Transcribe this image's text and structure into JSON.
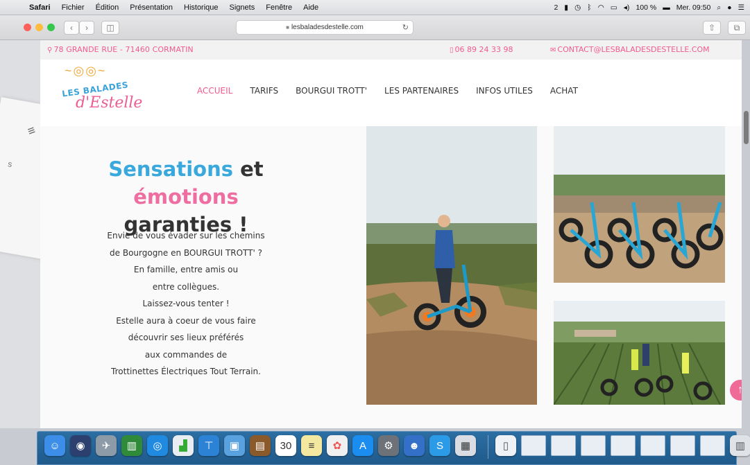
{
  "menubar": {
    "app": "Safari",
    "items": [
      "Fichier",
      "Édition",
      "Présentation",
      "Historique",
      "Signets",
      "Fenêtre",
      "Aide"
    ],
    "status": {
      "notif": "2",
      "battery": "100 %",
      "clock": "Mer. 09:50"
    }
  },
  "browser": {
    "url": "lesbaladesdestelle.com"
  },
  "site": {
    "topbar": {
      "address": "78 GRANDE RUE - 71460 CORMATIN",
      "phone": "06 89 24 33 98",
      "email": "CONTACT@LESBALADESDESTELLE.COM"
    },
    "logo": {
      "line1": "LES BALADES",
      "line2": "d'Estelle"
    },
    "nav": [
      "ACCUEIL",
      "TARIFS",
      "BOURGUI TROTT'",
      "LES PARTENAIRES",
      "INFOS UTILES",
      "ACHAT"
    ],
    "hero": {
      "title_part1": "Sensations",
      "title_part2": "et",
      "title_part3": "émotions",
      "title_line2": "garanties !",
      "body": [
        "Envie de vous évader sur les chemins",
        "de Bourgogne en BOURGUI TROTT' ?",
        "En famille, entre amis ou",
        "entre collègues.",
        "Laissez-vous tenter !",
        "Estelle aura à coeur de vous faire",
        "découvrir ses lieux préférés",
        "aux commandes de",
        "Trottinettes Électriques Tout Terrain."
      ]
    }
  },
  "colors": {
    "pink": "#f25a8e",
    "blue": "#39a8dc",
    "dark": "#333333"
  }
}
